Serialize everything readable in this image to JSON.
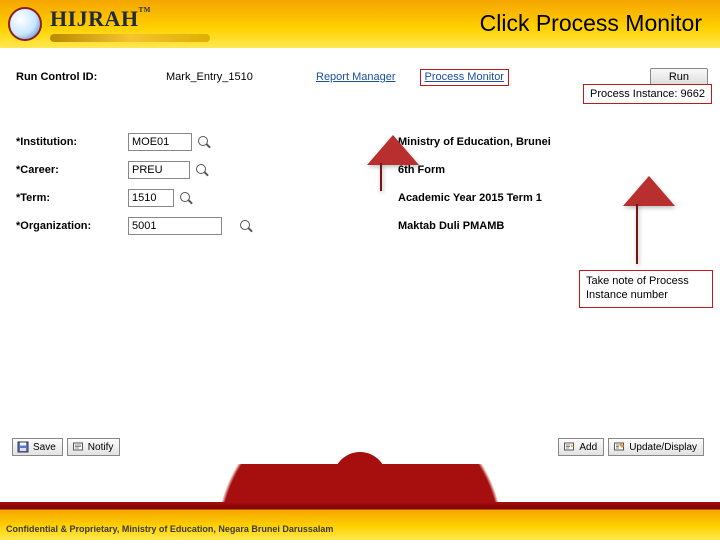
{
  "header": {
    "brand": "HIJRAH",
    "tm": "TM",
    "title": "Click Process Monitor"
  },
  "toprow": {
    "run_control_label": "Run Control ID:",
    "run_control_value": "Mark_Entry_1510",
    "report_manager": "Report Manager",
    "process_monitor": "Process Monitor",
    "run_button": "Run",
    "process_instance_label": "Process Instance:",
    "process_instance_value": "9662"
  },
  "form": {
    "institution": {
      "label": "*Institution:",
      "value": "MOE01",
      "desc": "Ministry of Education, Brunei"
    },
    "career": {
      "label": "*Career:",
      "value": "PREU",
      "desc": "6th Form"
    },
    "term": {
      "label": "*Term:",
      "value": "1510",
      "desc": "Academic Year 2015 Term 1"
    },
    "org": {
      "label": "*Organization:",
      "value": "5001",
      "desc": "Maktab Duli PMAMB"
    }
  },
  "callout": "Take note of Process Instance number",
  "toolbar": {
    "save": "Save",
    "notify": "Notify",
    "add": "Add",
    "update": "Update/Display"
  },
  "footer": "Confidential & Proprietary, Ministry of Education, Negara Brunei Darussalam"
}
